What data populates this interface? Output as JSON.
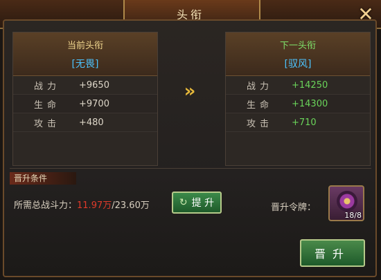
{
  "window": {
    "title": "头衔",
    "close_icon": "close-x-icon"
  },
  "current": {
    "label": "当前头衔",
    "value": "[无畏]",
    "stats": [
      {
        "name": "战力",
        "value": "+9650"
      },
      {
        "name": "生命",
        "value": "+9700"
      },
      {
        "name": "攻击",
        "value": "+480"
      }
    ]
  },
  "next": {
    "label": "下一头衔",
    "value": "[驭风]",
    "stats": [
      {
        "name": "战力",
        "value": "+14250"
      },
      {
        "name": "生命",
        "value": "+14300"
      },
      {
        "name": "攻击",
        "value": "+710"
      }
    ]
  },
  "upgrade_arrow": "»",
  "conditions": {
    "header": "晋升条件",
    "power_label": "所需总战斗力：",
    "power_current": "11.97万",
    "power_separator": "/",
    "power_required": "23.60万",
    "upgrade_button": "提 升",
    "token_label": "晋升令牌：",
    "token_count": "18/8"
  },
  "promote_button": "晋升"
}
